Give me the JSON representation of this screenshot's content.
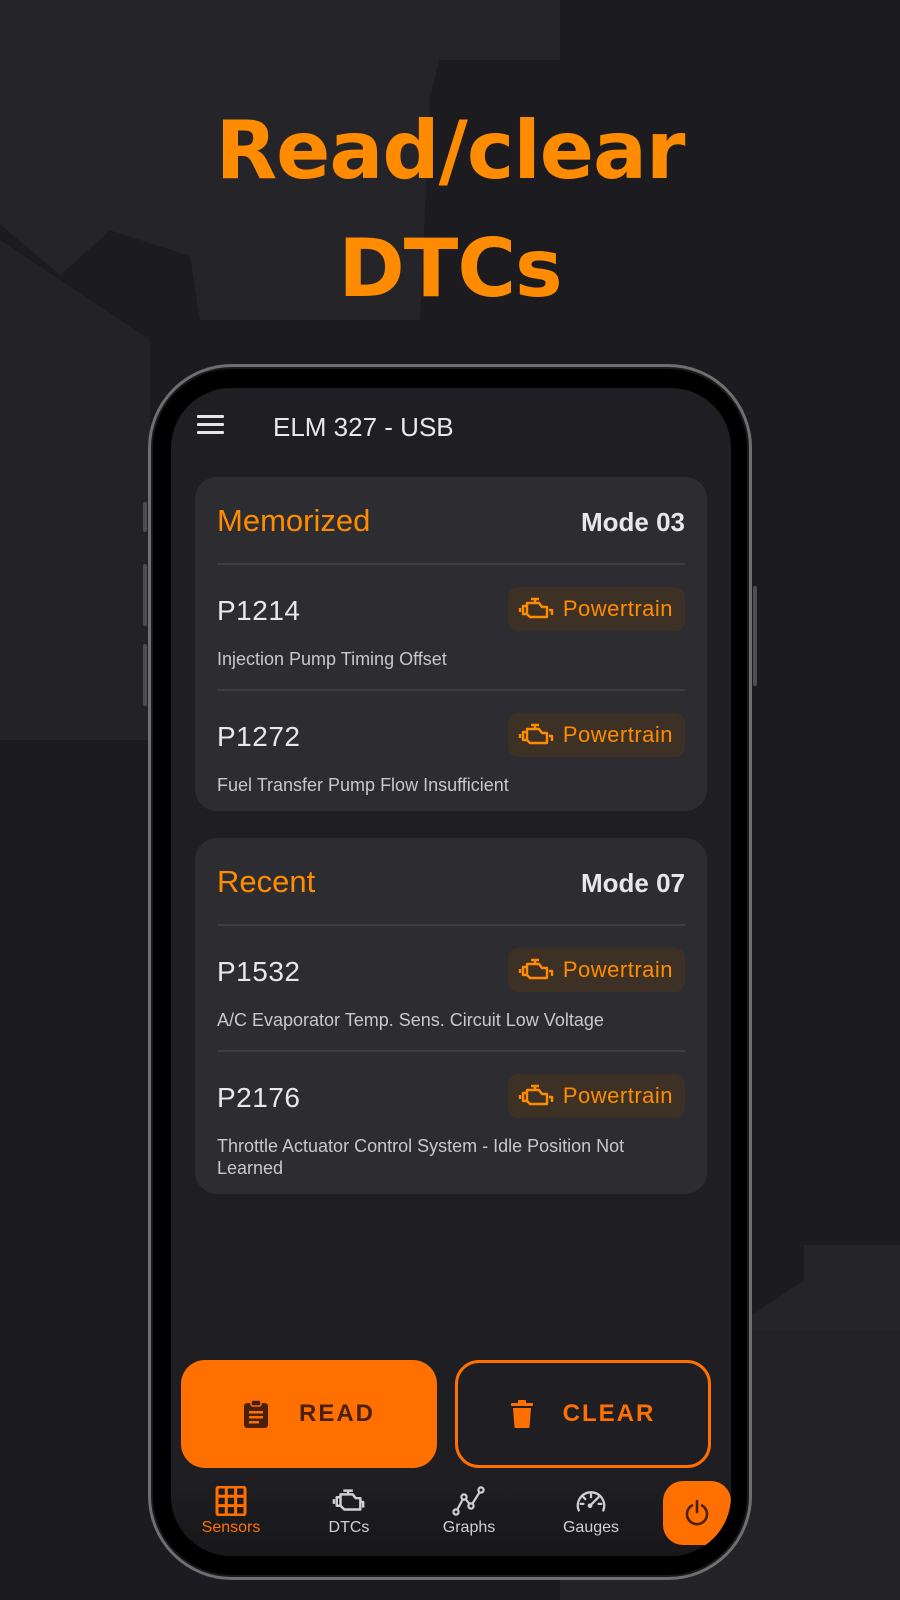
{
  "headline": {
    "line1": "Read/clear",
    "line2": "DTCs"
  },
  "app": {
    "title": "ELM 327 - USB"
  },
  "colors": {
    "accent": "#ff7000",
    "accent_text": "#ff8c00",
    "card_bg": "#2c2c31",
    "screen_bg": "#1f1f23"
  },
  "sections": [
    {
      "title": "Memorized",
      "mode": "Mode 03",
      "items": [
        {
          "code": "P1214",
          "category": "Powertrain",
          "category_icon": "engine-icon",
          "description": "Injection Pump Timing Offset"
        },
        {
          "code": "P1272",
          "category": "Powertrain",
          "category_icon": "engine-icon",
          "description": "Fuel Transfer Pump Flow Insufficient"
        }
      ]
    },
    {
      "title": "Recent",
      "mode": "Mode 07",
      "items": [
        {
          "code": "P1532",
          "category": "Powertrain",
          "category_icon": "engine-icon",
          "description": "A/C Evaporator Temp. Sens. Circuit Low Voltage"
        },
        {
          "code": "P2176",
          "category": "Powertrain",
          "category_icon": "engine-icon",
          "description": "Throttle Actuator Control System - Idle Position Not Learned"
        }
      ]
    }
  ],
  "actions": {
    "read": {
      "label": "READ",
      "icon": "clipboard-icon"
    },
    "clear": {
      "label": "CLEAR",
      "icon": "trash-icon"
    }
  },
  "nav": {
    "items": [
      {
        "label": "Sensors",
        "icon": "grid-icon",
        "active": true
      },
      {
        "label": "DTCs",
        "icon": "engine-icon",
        "active": false
      },
      {
        "label": "Graphs",
        "icon": "graph-icon",
        "active": false
      },
      {
        "label": "Gauges",
        "icon": "gauge-icon",
        "active": false
      }
    ],
    "power_icon": "power-icon"
  }
}
